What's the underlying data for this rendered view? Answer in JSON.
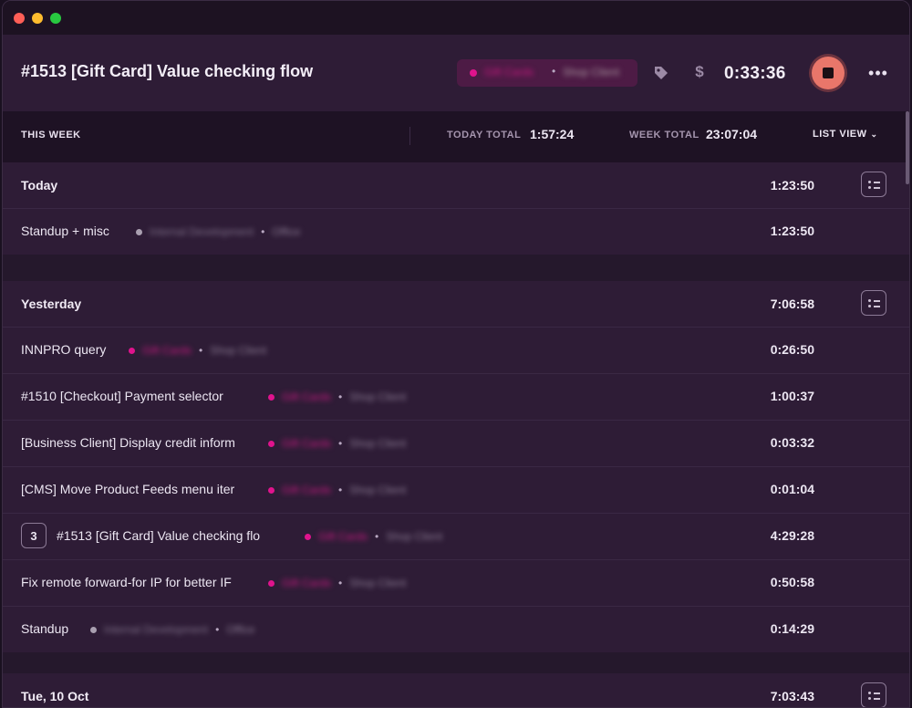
{
  "header": {
    "title": "#1513 [Gift Card] Value checking flow",
    "project": "Gift Cards",
    "client": "Shop Client",
    "timer": "0:33:36",
    "more_label": "•••"
  },
  "summary": {
    "this_week": "THIS WEEK",
    "today_total_label": "TODAY TOTAL",
    "today_total": "1:57:24",
    "week_total_label": "WEEK TOTAL",
    "week_total": "23:07:04",
    "list_view": "LIST VIEW"
  },
  "days": [
    {
      "label": "Today",
      "total": "1:23:50",
      "entries": [
        {
          "description": "Standup + misc",
          "project": "Internal Development",
          "client": "Office",
          "duration": "1:23:50"
        }
      ]
    },
    {
      "label": "Yesterday",
      "total": "7:06:58",
      "entries": [
        {
          "description": "INNPRO query",
          "project": "Gift Cards",
          "client": "Shop Client",
          "duration": "0:26:50"
        },
        {
          "description": "#1510 [Checkout] Payment selector",
          "project": "Gift Cards",
          "client": "Shop Client",
          "duration": "1:00:37"
        },
        {
          "description": "[Business Client] Display credit inform",
          "project": "Gift Cards",
          "client": "Shop Client",
          "duration": "0:03:32"
        },
        {
          "description": "[CMS] Move Product Feeds menu iter",
          "project": "Gift Cards",
          "client": "Shop Client",
          "duration": "0:01:04"
        },
        {
          "count": "3",
          "description": "#1513 [Gift Card] Value checking flo",
          "project": "Gift Cards",
          "client": "Shop Client",
          "duration": "4:29:28"
        },
        {
          "description": "Fix remote forward-for IP for better IF",
          "project": "Gift Cards",
          "client": "Shop Client",
          "duration": "0:50:58"
        },
        {
          "description": "Standup",
          "project": "Internal Development",
          "client": "Office",
          "duration": "0:14:29"
        }
      ]
    },
    {
      "label": "Tue, 10 Oct",
      "total": "7:03:43",
      "entries": []
    }
  ],
  "colors": {
    "accent": "#e0138d",
    "stop": "#e9766a",
    "background": "#2e1c36"
  },
  "icons": [
    "tag-icon",
    "dollar-icon",
    "stop-icon",
    "more-icon",
    "list-toggle-icon"
  ]
}
